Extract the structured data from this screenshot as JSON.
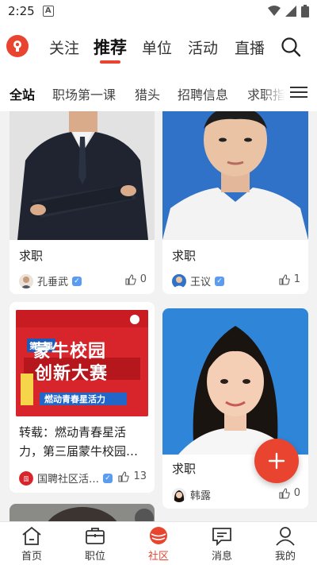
{
  "status": {
    "time": "2:25",
    "notification_badge": "A"
  },
  "top_tabs": [
    {
      "label": "关注"
    },
    {
      "label": "推荐",
      "active": true
    },
    {
      "label": "单位"
    },
    {
      "label": "活动"
    },
    {
      "label": "直播"
    }
  ],
  "sub_tabs": [
    {
      "label": "全站",
      "active": true
    },
    {
      "label": "职场第一课"
    },
    {
      "label": "猎头"
    },
    {
      "label": "招聘信息"
    },
    {
      "label": "求职指"
    }
  ],
  "posts": [
    {
      "title": "求职",
      "author": "孔垂武",
      "likes": "0",
      "image": "photo-man-crossed-arms"
    },
    {
      "title": "求职",
      "author": "王议",
      "likes": "1",
      "image": "photo-young-man-blue-bg"
    },
    {
      "title": "转载：燃动青春星活力，第三届蒙牛校园…",
      "author": "国聘社区活…",
      "likes": "13",
      "image": "poster-mengniu-campus-innovation",
      "poster_text": {
        "line1": "蒙牛校园",
        "line2": "创新大赛",
        "line3": "燃动青春星活力",
        "badge": "第三届"
      }
    },
    {
      "title": "求职",
      "author": "韩露",
      "likes": "0",
      "image": "photo-young-woman-blue-bg"
    }
  ],
  "fab": {
    "icon": "plus-icon"
  },
  "bottom_nav": [
    {
      "label": "首页",
      "icon": "home-icon"
    },
    {
      "label": "职位",
      "icon": "briefcase-icon"
    },
    {
      "label": "社区",
      "icon": "community-icon",
      "active": true
    },
    {
      "label": "消息",
      "icon": "message-icon"
    },
    {
      "label": "我的",
      "icon": "profile-icon"
    }
  ],
  "colors": {
    "accent": "#e8442f",
    "verified": "#5b9cf0",
    "photo_bg_blue": "#2f72c8",
    "poster_red": "#d8242b"
  }
}
